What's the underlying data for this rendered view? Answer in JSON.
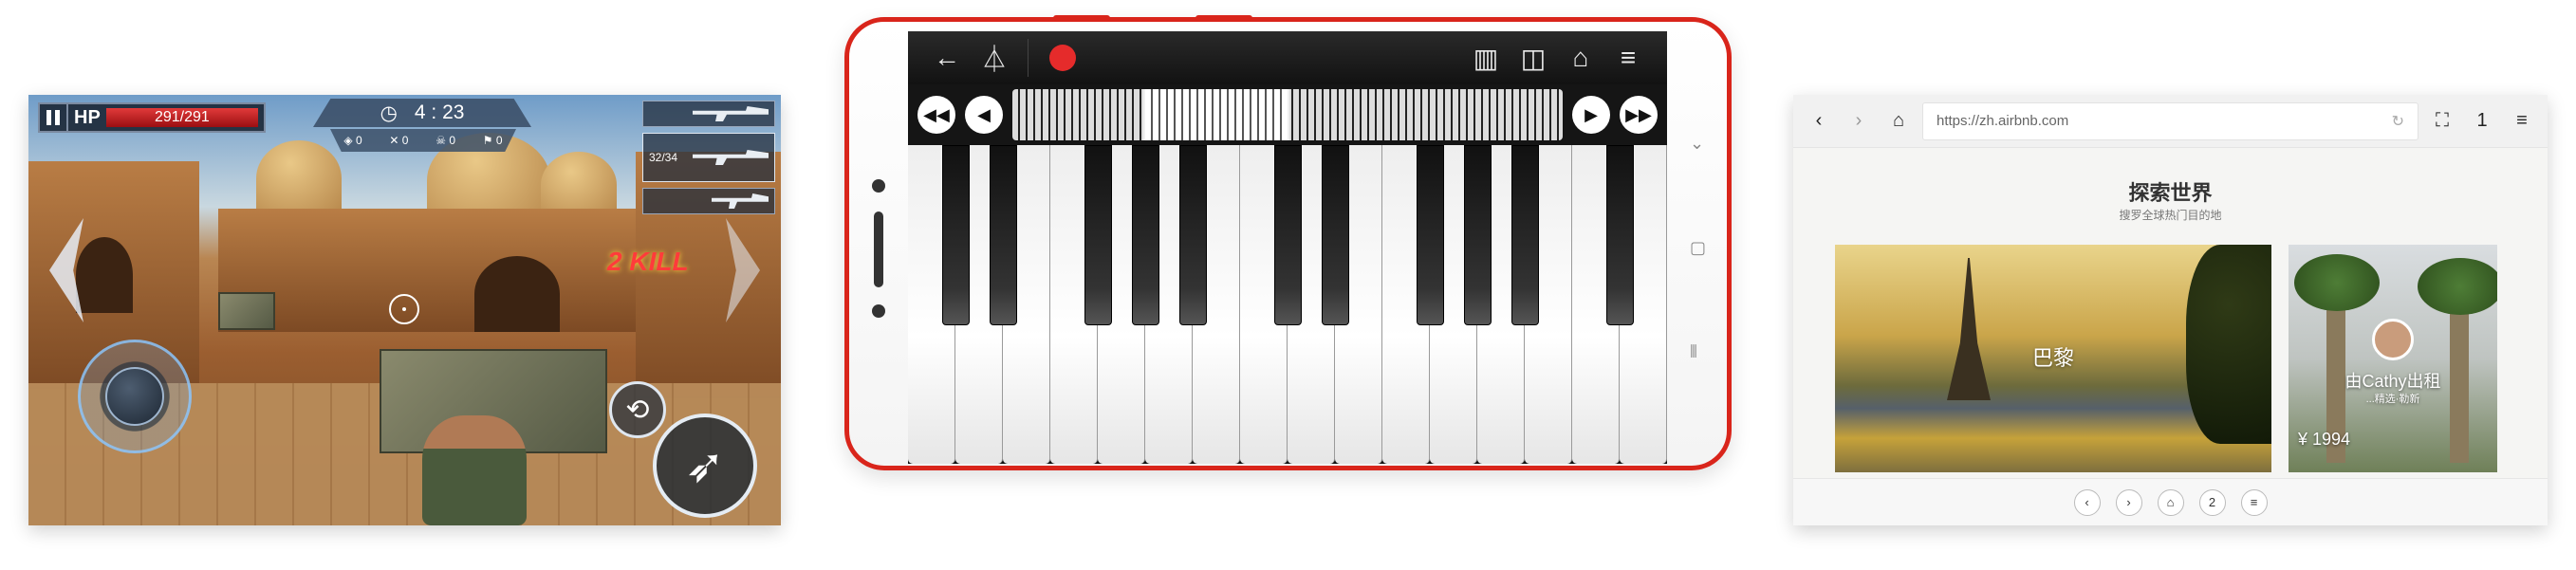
{
  "game": {
    "hp_label": "HP",
    "hp_value": "291/291",
    "timer": "4 : 23",
    "stats": [
      "0",
      "0",
      "0",
      "0"
    ],
    "weapons": [
      {
        "ammo": ""
      },
      {
        "ammo": "32/34"
      },
      {
        "ammo": ""
      }
    ],
    "kill_badge": "2 KILL",
    "icons": {
      "pause": "pause-icon",
      "clock": "clock-icon",
      "reload": "reload-icon",
      "fire": "missile-icon"
    }
  },
  "piano": {
    "toolbar": {
      "back": "←",
      "metronome": "metronome-icon",
      "piano_mode": "keyboard-icon",
      "dual_mode": "split-keys-icon",
      "grand": "grand-piano-icon",
      "menu": "≡"
    },
    "nav": {
      "fast_back": "◀◀",
      "back": "◀",
      "fwd": "▶",
      "fast_fwd": "▶▶"
    },
    "side_nav": [
      "⌄",
      "▢",
      "⦀"
    ]
  },
  "browser": {
    "url": "https://zh.airbnb.com",
    "tab_count": "1",
    "title": "探索世界",
    "subtitle": "搜罗全球热门目的地",
    "card_main_label": "巴黎",
    "card_side_name": "由Cathy出租",
    "card_side_sub": "...精选·勒新",
    "card_side_price": "¥ 1994",
    "bottom_bar": {
      "back": "‹",
      "fwd": "›",
      "home": "⌂",
      "tabs": "2",
      "menu": "≡"
    }
  },
  "colors": {
    "phone_accent": "#d9251b",
    "record": "#e52b2b",
    "hp_red": "#e13a3a"
  }
}
